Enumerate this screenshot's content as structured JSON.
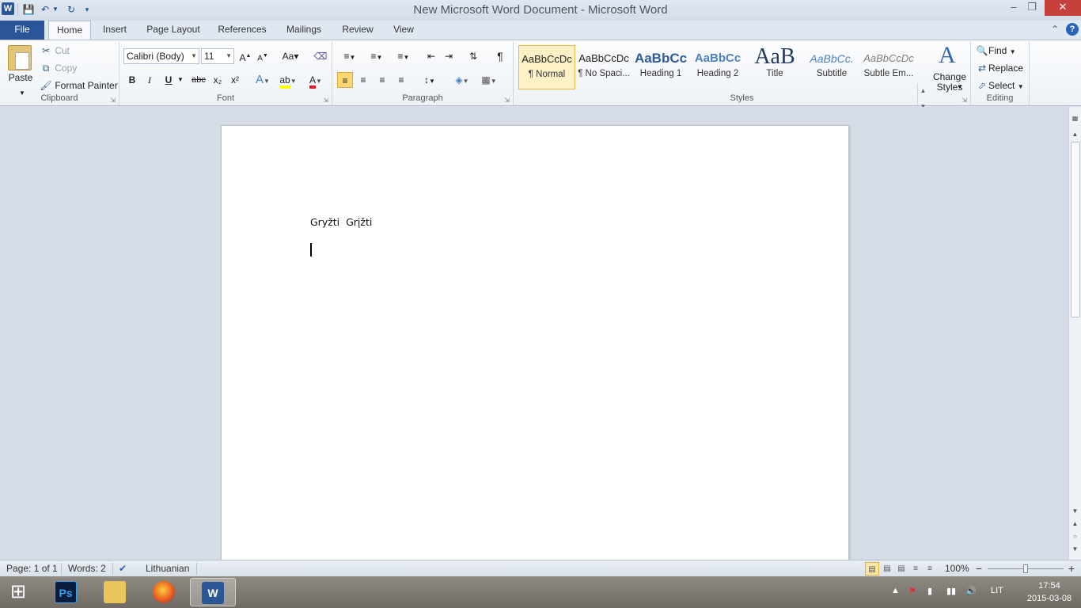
{
  "window": {
    "title": "New Microsoft Word Document  -  Microsoft Word",
    "app_logo": "W",
    "quick_access": [
      "save-icon",
      "undo-icon",
      "redo-icon",
      "customize-qat-icon"
    ],
    "controls": [
      "minimize-icon",
      "restore-icon",
      "close-icon"
    ]
  },
  "tabs": {
    "file": "File",
    "items": [
      "Home",
      "Insert",
      "Page Layout",
      "References",
      "Mailings",
      "Review",
      "View"
    ],
    "active": "Home"
  },
  "clipboard": {
    "paste": "Paste",
    "cut": "Cut",
    "copy": "Copy",
    "format_painter": "Format Painter",
    "label": "Clipboard"
  },
  "font": {
    "name": "Calibri (Body)",
    "size": "11",
    "change_case": "Aa",
    "label": "Font",
    "bold": "B",
    "italic": "I",
    "underline": "U",
    "strikethrough": "abc",
    "subscript": "x₂",
    "superscript": "x²"
  },
  "paragraph": {
    "label": "Paragraph",
    "pilcrow": "¶"
  },
  "styles": {
    "label": "Styles",
    "items": [
      {
        "sample": "AaBbCcDc",
        "name": "¶ Normal"
      },
      {
        "sample": "AaBbCcDc",
        "name": "¶ No Spaci..."
      },
      {
        "sample": "AaBbCc",
        "name": "Heading 1"
      },
      {
        "sample": "AaBbCc",
        "name": "Heading 2"
      },
      {
        "sample": "AaB",
        "name": "Title"
      },
      {
        "sample": "AaBbCc.",
        "name": "Subtitle"
      },
      {
        "sample": "AaBbCcDc",
        "name": "Subtle Em..."
      }
    ],
    "selected": "¶ Normal",
    "change_styles": "Change Styles",
    "change_styles_icon": "A"
  },
  "editing": {
    "label": "Editing",
    "find": "Find",
    "replace": "Replace",
    "select": "Select"
  },
  "document": {
    "text": "Gryžti  Grįžti"
  },
  "status": {
    "page": "Page: 1 of 1",
    "words": "Words: 2",
    "language": "Lithuanian",
    "zoom": "100%",
    "zoom_minus": "−",
    "zoom_plus": "+",
    "zoom_level": 0.5
  },
  "taskbar": {
    "apps": [
      "Ps",
      "Explorer",
      "Firefox",
      "W"
    ],
    "language": "LIT",
    "time": "17:54",
    "date": "2015-03-08"
  },
  "colors": {
    "file_tab": "#2a5699",
    "close_button": "#c6413c",
    "selected_style": "#fdf1c5",
    "accent": "#2b5797"
  }
}
